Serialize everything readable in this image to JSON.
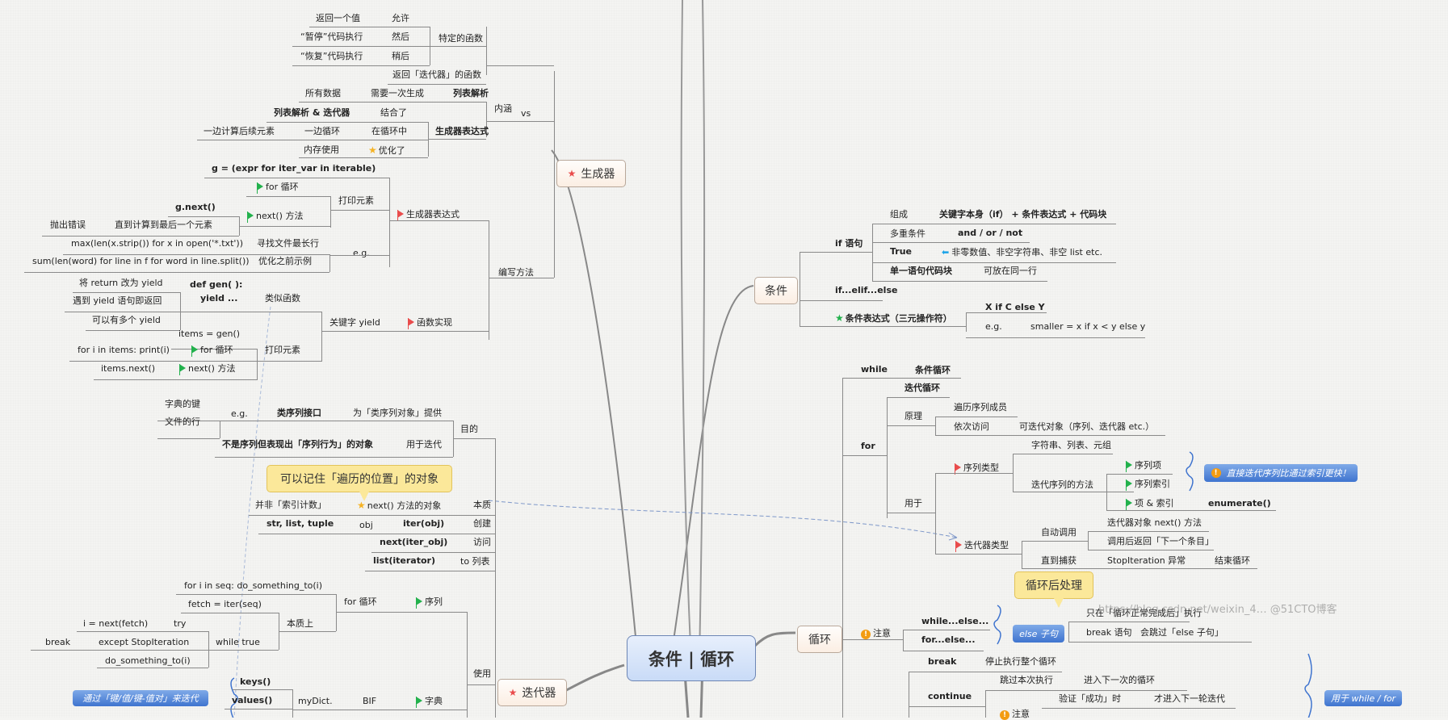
{
  "central": "条件 | 循环",
  "generator": {
    "title": "生成器",
    "neihan": {
      "label": "内涵",
      "special_func": "特定的函数",
      "rows": [
        {
          "a": "返回一个值",
          "b": "允许"
        },
        {
          "a": "“暂停”代码执行",
          "b": "然后"
        },
        {
          "a": "“恢复”代码执行",
          "b": "稍后"
        }
      ],
      "returns_iter": "返回「迭代器」的函数"
    },
    "vs": {
      "label": "vs",
      "listcomp": "列表解析",
      "all_data": "所有数据",
      "need_once": "需要一次生成",
      "genexp": "生成器表达式",
      "combo": "列表解析 & 迭代器",
      "combined": "结合了",
      "calc_next": "一边计算后续元素",
      "loop_side": "一边循环",
      "in_loop": "在循环中",
      "memory": "内存使用",
      "optimized": "优化了"
    },
    "write": {
      "label": "编写方法",
      "genexp_flag": "生成器表达式",
      "syntax": "g = (expr for iter_var in iterable)",
      "print_elem": "打印元素",
      "for_loop": "for 循环",
      "next_method": "next() 方法",
      "gnext": "g.next()",
      "until_last": "直到计算到最后一个元素",
      "throw_err": "抛出错误",
      "eg": "e.g.",
      "ex1_code": "max(len(x.strip()) for x in open('*.txt'))",
      "ex1_desc": "寻找文件最长行",
      "ex2_code": "sum(len(word) for line in f for word in line.split())",
      "ex2_desc": "优化之前示例",
      "func_impl": "函数实现",
      "yield_kw": "关键字 yield",
      "like_func": "类似函数",
      "defgen1": "def gen( ):",
      "defgen2": "yield ...",
      "yield_notes": [
        "将 return 改为 yield",
        "遇到 yield 语句即返回",
        "可以有多个 yield"
      ],
      "print_elem2": "打印元素",
      "items_gen": "items = gen()",
      "for_code": "for i in items: print(i)",
      "for_loop2": "for 循环",
      "items_next": "items.next()",
      "next_method2": "next() 方法"
    }
  },
  "iterator": {
    "title": "迭代器",
    "purpose": {
      "label": "目的",
      "provide": "为「类序列对象」提供",
      "seq_iface": "类序列接口",
      "eg": "e.g.",
      "eg_items": [
        "字典的键",
        "文件的行"
      ],
      "for_iter": "用于迭代",
      "not_seq": "不是序列但表现出「序列行为」的对象"
    },
    "callout": "可以记住「遍历的位置」的对象",
    "essence": {
      "label": "本质",
      "next_obj": "next() 方法的对象",
      "not_index": "并非「索引计数」"
    },
    "create": {
      "label": "创建",
      "iter_obj": "iter(obj)",
      "obj": "obj",
      "types": "str, list, tuple"
    },
    "access": {
      "label": "访问",
      "value": "next(iter_obj)"
    },
    "tolist": {
      "label": "to 列表",
      "value": "list(iterator)"
    },
    "use": {
      "label": "使用",
      "seq": "序列",
      "for_loop": "for 循环",
      "for_code": "for i in seq: do_something_to(i)",
      "essentially": "本质上",
      "fetch": "fetch = iter(seq)",
      "while_true": "while true",
      "try": "try",
      "i_next": "i = next(fetch)",
      "except": "except StopIteration",
      "break": "break",
      "do_something": "do_something_to(i)",
      "dict": "字典",
      "bif": "BIF",
      "mydict": "myDict.",
      "keys": "keys()",
      "values": "values()",
      "summary": "通过「键/值/键-值对」来迭代"
    }
  },
  "condition": {
    "title": "条件",
    "if_stmt": "if 语句",
    "rows": [
      {
        "a": "组成",
        "b": "关键字本身（if） + 条件表达式 + 代码块"
      },
      {
        "a": "多重条件",
        "b": "and / or / not"
      },
      {
        "a": "True",
        "b": "非零数值、非空字符串、非空 list etc."
      },
      {
        "a": "单一语句代码块",
        "b": "可放在同一行"
      }
    ],
    "elif": "if...elif...else",
    "ternary": "条件表达式（三元操作符）",
    "ternary_syntax": "X if C else Y",
    "eg": "e.g.",
    "eg_code": "smaller = x if x < y else y"
  },
  "loop": {
    "title": "循环",
    "while": "while",
    "cond_loop": "条件循环",
    "for": "for",
    "iter_loop": "迭代循环",
    "principle": "原理",
    "traverse": "遍历序列成员",
    "visit": "依次访问",
    "iterable": "可迭代对象（序列、迭代器 etc.）",
    "usedfor": "用于",
    "seq_type": "序列类型",
    "str_list_tuple": "字符串、列表、元组",
    "iter_methods": "迭代序列的方法",
    "seq_item": "序列项",
    "seq_index": "序列索引",
    "item_index": "项 & 索引",
    "enumerate": "enumerate()",
    "faster": "直接迭代序列比通过索引更快！",
    "iter_type": "迭代器类型",
    "auto_call": "自动调用",
    "next_method": "迭代器对象 next() 方法",
    "returns_next": "调用后返回「下一个条目」",
    "until_catch": "直到捕获",
    "stopiter": "StopIteration 异常",
    "end_loop": "结束循环",
    "callout": "循环后处理",
    "note": "注意",
    "while_else": "while...else...",
    "for_else": "for...else...",
    "else_clause": "else 子句",
    "only_normal": "只在「循环正常完成后」执行",
    "break_stmt": "break 语句",
    "skip_else": "会跳过「else 子句」",
    "break": "break",
    "stop_loop": "停止执行整个循环",
    "continue": "continue",
    "skip_this": "跳过本次执行",
    "next_round": "进入下一次的循环",
    "note2": "注意",
    "verify": "验证「成功」时",
    "next_iter": "才进入下一轮迭代",
    "summary2": "用于 while / for"
  },
  "watermark": "https://blog.csdn.net/weixin_4…  @51CTO博客"
}
